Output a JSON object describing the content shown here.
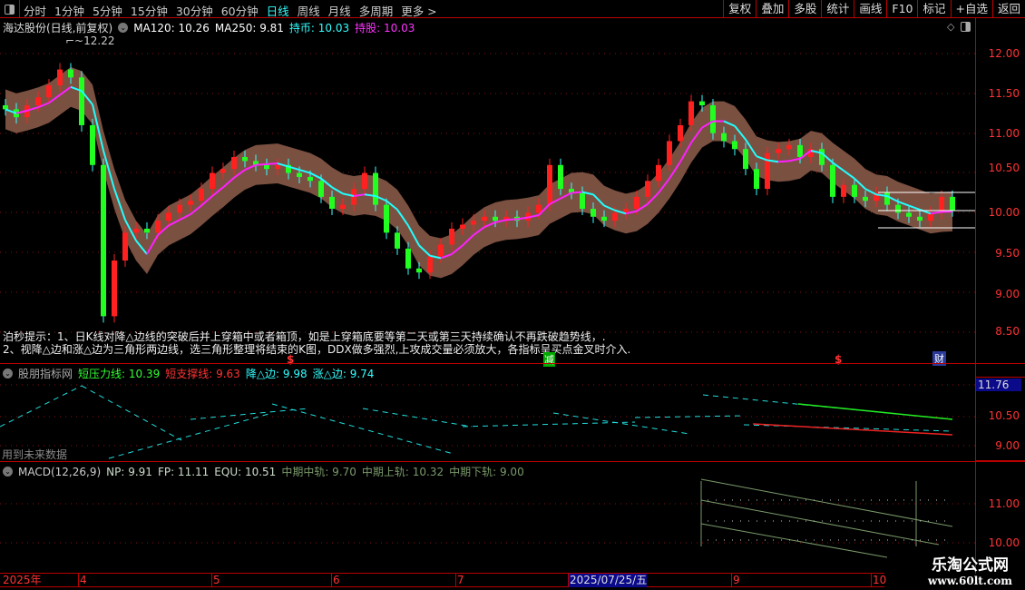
{
  "toolbar": {
    "periods": [
      "分时",
      "1分钟",
      "5分钟",
      "15分钟",
      "30分钟",
      "60分钟",
      "日线",
      "周线",
      "月线",
      "多周期",
      "更多 >"
    ],
    "active": "日线",
    "right_buttons": [
      "复权",
      "叠加",
      "多股",
      "统计",
      "画线",
      "F10",
      "标记",
      "+自选",
      "返回"
    ]
  },
  "main": {
    "title": "海达股份(日线,前复权)",
    "ma120": "MA120: 10.26",
    "ma250": "MA250: 9.81",
    "chibi": "持币: 10.03",
    "chigu": "持股: 10.03",
    "high_label": "12.22",
    "axis_ticks": [
      "12.00",
      "11.50",
      "11.00",
      "10.50",
      "10.00",
      "9.50",
      "9.00",
      "8.50"
    ],
    "tip_line1": "泊秒提示：1、日K线对降△边线的突破后并上穿箱中或者箱顶，如是上穿箱底要等第二天或第三天持续确认不再跌破趋势线，.",
    "tip_line2": "2、视降△边和涨△边为三角形两边线，选三角形整理将结束的K图，DDX做多强烈,上攻成交量必须放大，各指标呈买点金叉时介入.",
    "markers": {
      "dollar1": "$",
      "jian": "减",
      "dollar2": "$",
      "cai": "财"
    },
    "colors": {
      "up": "#ff2020",
      "down": "#20ff20",
      "band": "#7a5040",
      "ma_up": "#ff20ff",
      "ma_down": "#20ffff"
    },
    "closes": [
      11.3,
      11.2,
      11.35,
      11.45,
      11.6,
      11.8,
      11.7,
      11.1,
      10.6,
      8.7,
      9.4,
      9.75,
      9.8,
      9.75,
      9.9,
      10.0,
      10.1,
      10.15,
      10.3,
      10.5,
      10.55,
      10.7,
      10.65,
      10.6,
      10.55,
      10.6,
      10.5,
      10.45,
      10.4,
      10.2,
      10.05,
      10.1,
      10.3,
      10.5,
      10.1,
      9.75,
      9.55,
      9.3,
      9.25,
      9.45,
      9.6,
      9.8,
      9.85,
      9.9,
      9.95,
      9.9,
      9.95,
      9.9,
      10.0,
      10.1,
      10.6,
      10.3,
      10.25,
      10.05,
      9.95,
      9.9,
      10.0,
      10.05,
      10.2,
      10.4,
      10.6,
      10.9,
      11.1,
      11.4,
      11.35,
      11.0,
      10.9,
      10.8,
      10.55,
      10.3,
      10.75,
      10.8,
      10.85,
      10.7,
      10.8,
      10.6,
      10.2,
      10.35,
      10.2,
      10.15,
      10.25,
      10.1,
      10.0,
      9.95,
      9.9,
      10.0,
      10.2,
      10.03
    ]
  },
  "panel2": {
    "name": "股朋指标网",
    "l1": "短压力线: 10.39",
    "l2": "短支撑线: 9.63",
    "l3": "降△边: 9.98",
    "l4": "涨△边: 9.74",
    "note": "用到未来数据",
    "axis_ticks": [
      "11.76",
      "10.50",
      "9.00"
    ]
  },
  "panel3": {
    "name": "MACD(12,26,9)",
    "np": "NP: 9.91",
    "fp": "FP: 11.11",
    "equ": "EQU: 10.51",
    "mid": "中期中轨: 9.70",
    "up": "中期上轨: 10.32",
    "down": "中期下轨: 9.00",
    "axis_ticks": [
      "11.00",
      "10.00"
    ]
  },
  "timeaxis": {
    "labels": [
      "2025年",
      "4",
      "5",
      "6",
      "7",
      "2025/07/25/五",
      "9",
      "10"
    ]
  },
  "watermark": {
    "line1": "乐淘公式网",
    "line2": "www.60lt.com"
  }
}
